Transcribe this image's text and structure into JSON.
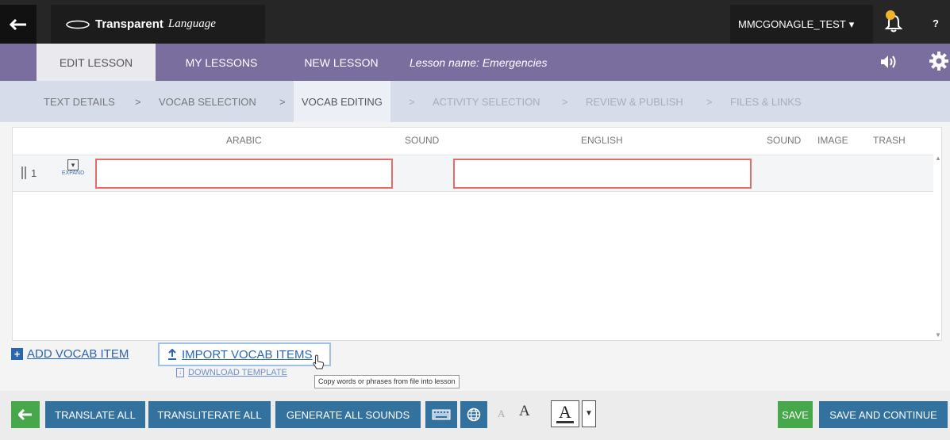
{
  "topbar": {
    "brand": "Transparent",
    "brand_suffix": "Language",
    "username": "MMCGONAGLE_TEST",
    "user_caret": "▾",
    "help_glyph": "?"
  },
  "lesson_tabs": [
    {
      "label": "EDIT LESSON",
      "active": true
    },
    {
      "label": "MY LESSONS",
      "active": false
    },
    {
      "label": "NEW LESSON",
      "active": false
    }
  ],
  "lesson_name": "Lesson name: Emergencies",
  "steps": [
    {
      "label": "TEXT DETAILS",
      "state": "done"
    },
    {
      "label": "VOCAB SELECTION",
      "state": "done"
    },
    {
      "label": "VOCAB EDITING",
      "state": "current"
    },
    {
      "label": "ACTIVITY SELECTION",
      "state": "disabled"
    },
    {
      "label": "REVIEW & PUBLISH",
      "state": "disabled"
    },
    {
      "label": "FILES & LINKS",
      "state": "disabled"
    }
  ],
  "step_separator": ">",
  "grid": {
    "columns": [
      "ARABIC",
      "SOUND",
      "ENGLISH",
      "SOUND",
      "IMAGE",
      "TRASH"
    ],
    "rows": [
      {
        "number": "1",
        "expand_label": "EXPAND",
        "arabic": "",
        "english": ""
      }
    ]
  },
  "links": {
    "add_vocab": "ADD VOCAB ITEM",
    "import_vocab": "IMPORT VOCAB ITEMS",
    "download_template": "DOWNLOAD TEMPLATE",
    "tooltip": "Copy words or phrases from file into lesson"
  },
  "bottom_bar": {
    "translate_all": "TRANSLATE ALL",
    "transliterate_all": "TRANSLITERATE ALL",
    "generate_all_sounds": "GENERATE ALL SOUNDS",
    "font_small": "A",
    "font_large": "A",
    "font_color": "A",
    "save": "SAVE",
    "save_and_continue": "SAVE AND CONTINUE"
  },
  "colors": {
    "topbar": "#262626",
    "purple": "#7a6e9e",
    "steps": "#d7dcea",
    "button_blue": "#33719e",
    "button_green": "#46a84a",
    "error_border": "#e66b6b",
    "link": "#2a66b0",
    "bell_badge": "#f0b429"
  },
  "icons": [
    "back-arrow-icon",
    "logo-swoosh-icon",
    "bell-icon",
    "help-icon",
    "speaker-icon",
    "gear-icon",
    "grip-icon",
    "expand-icon",
    "plus-icon",
    "upload-icon",
    "file-icon",
    "back-arrow-icon",
    "keyboard-icon",
    "globe-icon",
    "chevron-down-icon"
  ]
}
